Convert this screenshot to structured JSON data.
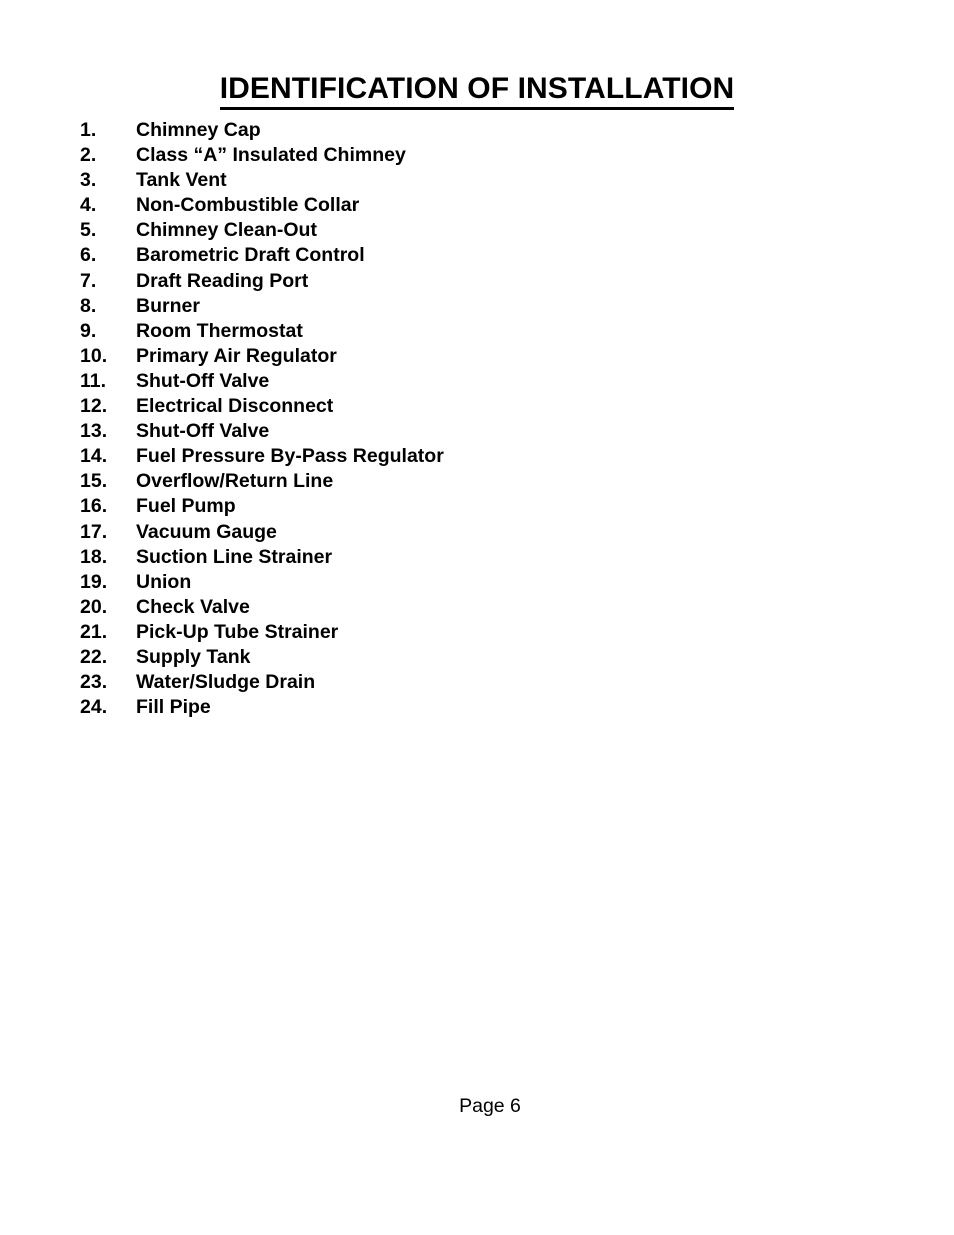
{
  "document": {
    "title": "IDENTIFICATION OF INSTALLATION",
    "background_color": "#ffffff",
    "text_color": "#000000"
  },
  "identification_list": {
    "items": [
      {
        "number": "1.",
        "label": "Chimney Cap"
      },
      {
        "number": "2.",
        "label": "Class “A” Insulated Chimney"
      },
      {
        "number": "3.",
        "label": "Tank Vent"
      },
      {
        "number": "4.",
        "label": "Non-Combustible Collar"
      },
      {
        "number": "5.",
        "label": "Chimney Clean-Out"
      },
      {
        "number": "6.",
        "label": "Barometric Draft Control"
      },
      {
        "number": "7.",
        "label": "Draft Reading Port"
      },
      {
        "number": "8.",
        "label": "Burner"
      },
      {
        "number": "9.",
        "label": "Room Thermostat"
      },
      {
        "number": "10.",
        "label": "Primary Air Regulator"
      },
      {
        "number": "11.",
        "label": "Shut-Off Valve"
      },
      {
        "number": "12.",
        "label": "Electrical Disconnect"
      },
      {
        "number": "13.",
        "label": "Shut-Off Valve"
      },
      {
        "number": "14.",
        "label": "Fuel Pressure By-Pass Regulator"
      },
      {
        "number": "15.",
        "label": "Overflow/Return Line"
      },
      {
        "number": "16.",
        "label": "Fuel Pump"
      },
      {
        "number": "17.",
        "label": "Vacuum Gauge"
      },
      {
        "number": "18.",
        "label": "Suction Line Strainer"
      },
      {
        "number": "19.",
        "label": "Union"
      },
      {
        "number": "20.",
        "label": "Check Valve"
      },
      {
        "number": "21.",
        "label": "Pick-Up Tube Strainer"
      },
      {
        "number": "22.",
        "label": "Supply Tank"
      },
      {
        "number": "23.",
        "label": "Water/Sludge Drain"
      },
      {
        "number": "24.",
        "label": "Fill Pipe"
      }
    ]
  },
  "footer": {
    "page_label": "Page 6"
  }
}
